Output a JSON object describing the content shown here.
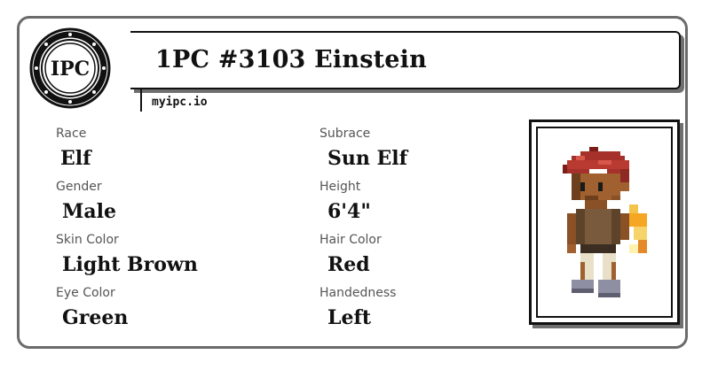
{
  "card": {
    "title": "1PC #3103 Einstein",
    "domain": "myipc.io",
    "logo_text": "IPC",
    "logo_icon": "ipc-seal-icon"
  },
  "fields": {
    "race": {
      "label": "Race",
      "value": "Elf"
    },
    "subrace": {
      "label": "Subrace",
      "value": "Sun Elf"
    },
    "gender": {
      "label": "Gender",
      "value": "Male"
    },
    "height": {
      "label": "Height",
      "value": "6'4\""
    },
    "skin_color": {
      "label": "Skin Color",
      "value": "Light Brown"
    },
    "hair_color": {
      "label": "Hair Color",
      "value": "Red"
    },
    "eye_color": {
      "label": "Eye Color",
      "value": "Green"
    },
    "handedness": {
      "label": "Handedness",
      "value": "Left"
    }
  },
  "portrait": {
    "icon": "pixel-character-portrait"
  },
  "colors": {
    "border": "#6b6b6b",
    "label": "#555555",
    "text": "#111111",
    "hair": "#a5312a",
    "skin": "#a0602f"
  }
}
